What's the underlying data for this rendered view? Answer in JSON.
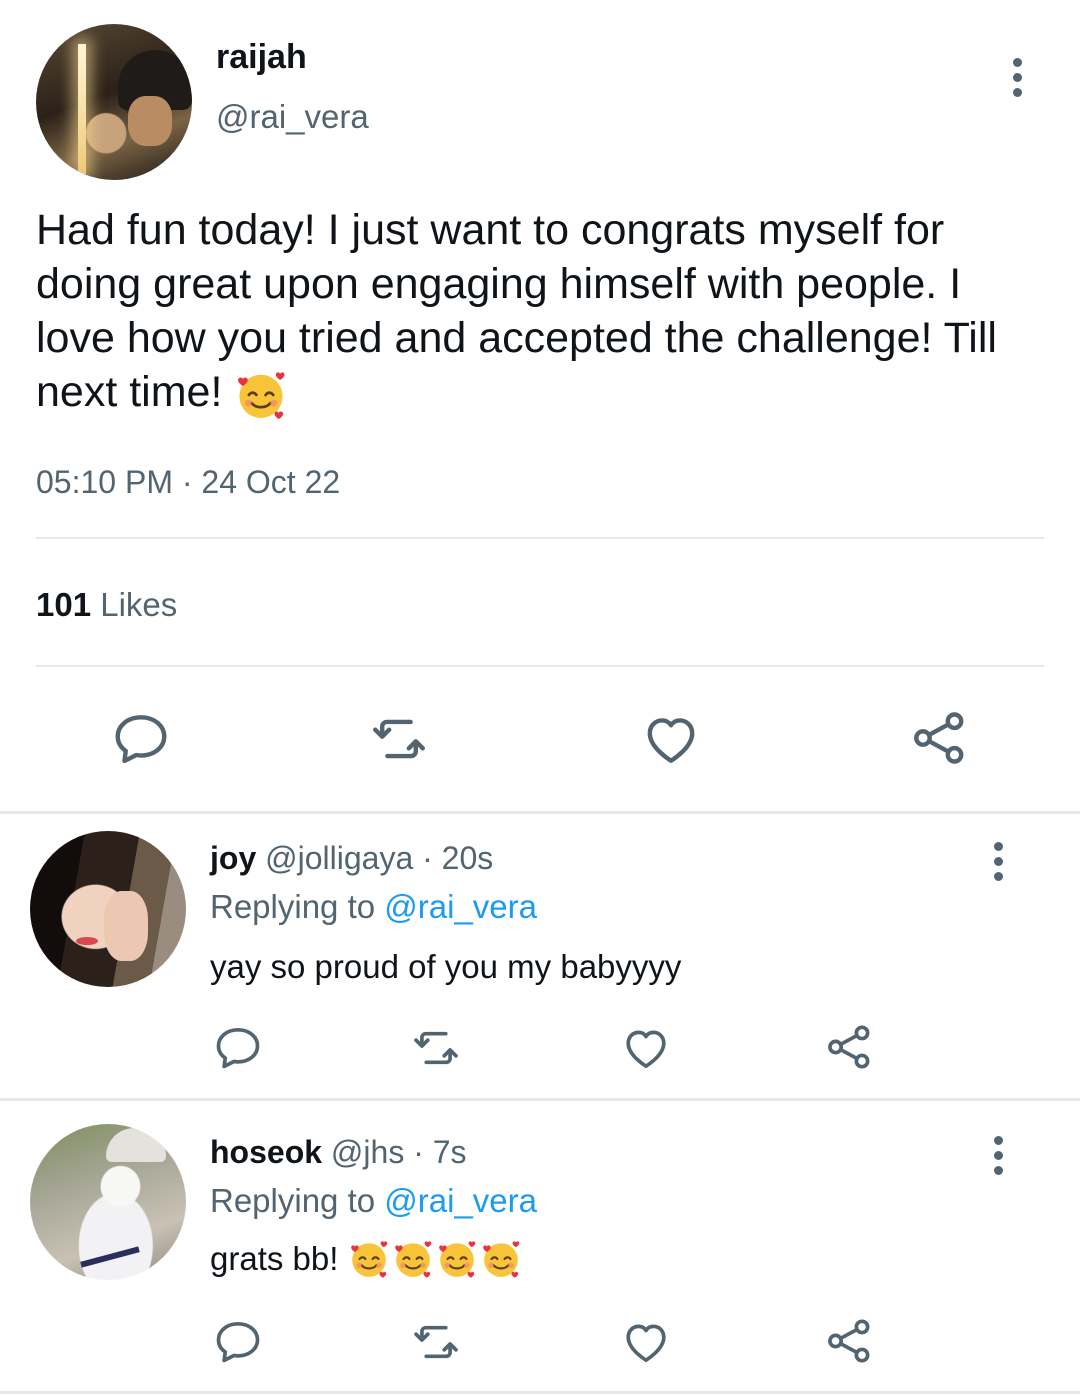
{
  "tweet": {
    "display_name": "raijah",
    "handle": "@rai_vera",
    "text": "Had fun today! I just want to congrats myself for doing great upon engaging himself with people. I love how you tried and accepted the challenge! Till next time!",
    "emoji": "smiling-face-with-hearts",
    "timestamp": "05:10 PM · 24 Oct 22",
    "likes_count": "101",
    "likes_label": "Likes"
  },
  "replies": [
    {
      "name": "joy",
      "handle": "@jolligaya",
      "time": "· 20s",
      "replying_prefix": "Replying to",
      "replying_to": "@rai_vera",
      "text": "yay so proud of you my babyyyy",
      "emoji_count": 0
    },
    {
      "name": "hoseok",
      "handle": "@jhs",
      "time": "· 7s",
      "replying_prefix": "Replying to",
      "replying_to": "@rai_vera",
      "text": "grats bb!",
      "emoji_count": 4
    }
  ],
  "icons": {
    "reply": "speech-bubble-icon",
    "retweet": "retweet-arrows-icon",
    "like": "heart-outline-icon",
    "share": "share-nodes-icon",
    "more": "vertical-dots-icon"
  },
  "colors": {
    "text": "#0f1419",
    "secondary": "#536471",
    "link": "#1d9bf0",
    "divider": "#e6e9ea"
  }
}
